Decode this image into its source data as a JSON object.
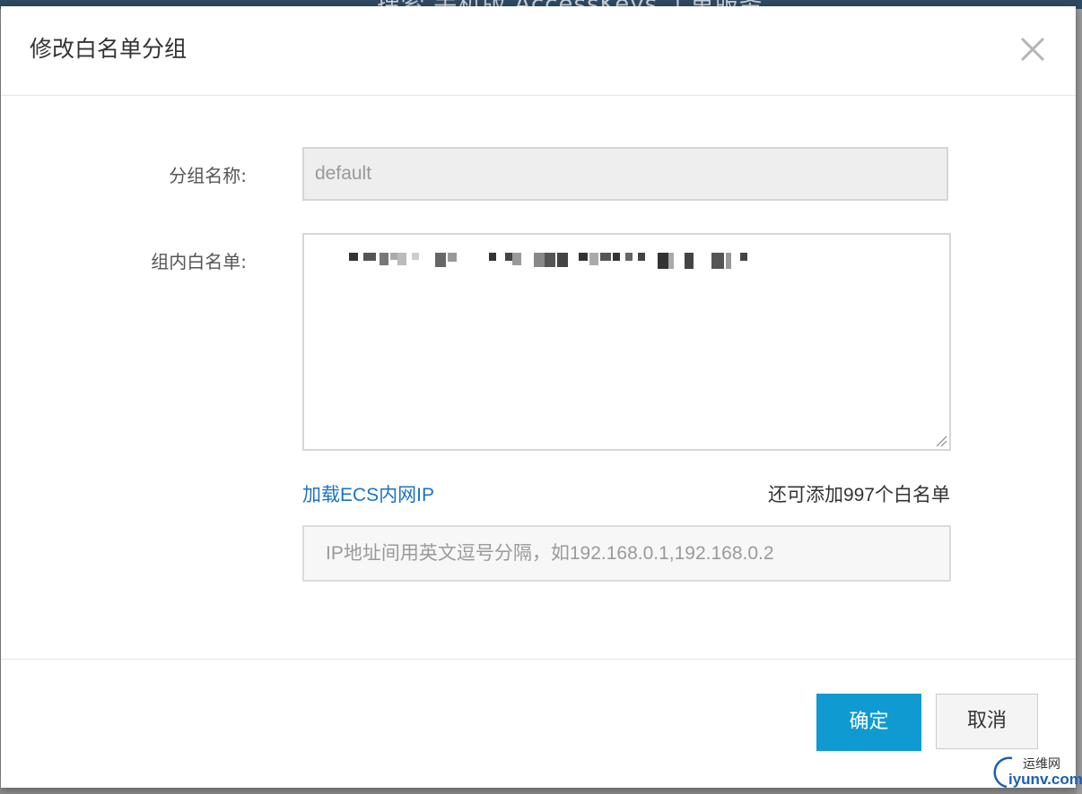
{
  "background": {
    "topbar_text": "搜索   手机版   AccessKeys   工单服务"
  },
  "dialog": {
    "title": "修改白名单分组",
    "close_icon": "close-icon",
    "form": {
      "group_name_label": "分组名称:",
      "group_name_value": "default",
      "whitelist_label": "组内白名单:",
      "whitelist_value_obscured": true,
      "load_ecs_link": "加载ECS内网IP",
      "remaining_text": "还可添加997个白名单",
      "ip_input_placeholder": "IP地址间用英文逗号分隔，如192.168.0.1,192.168.0.2"
    },
    "footer": {
      "confirm_label": "确定",
      "cancel_label": "取消"
    }
  },
  "watermark": {
    "cn": "运维网",
    "en": "iyunv.com"
  },
  "colors": {
    "primary_button": "#0f9bd1",
    "link": "#1a73c4",
    "overlay": "#8c8c8c"
  }
}
